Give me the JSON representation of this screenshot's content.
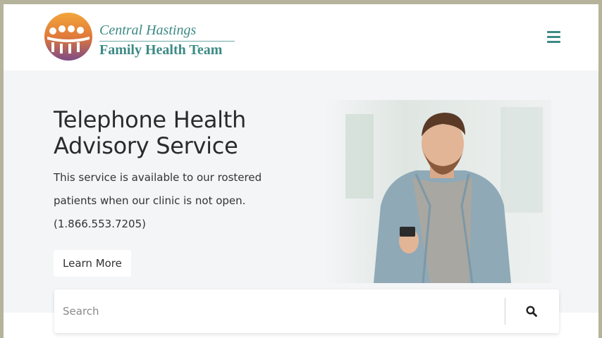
{
  "header": {
    "logo_line1": "Central Hastings",
    "logo_line2": "Family Health Team",
    "menu_icon": "hamburger-menu-icon",
    "brand_color": "#3c8a84"
  },
  "hero": {
    "title": "Telephone Health Advisory Service",
    "description": "This service is available to our rostered patients when our clinic is not open. (1.866.553.7205)",
    "button_label": "Learn More",
    "background": "#f4f5f7"
  },
  "search": {
    "placeholder": "Search",
    "value": "",
    "icon": "search-icon"
  }
}
